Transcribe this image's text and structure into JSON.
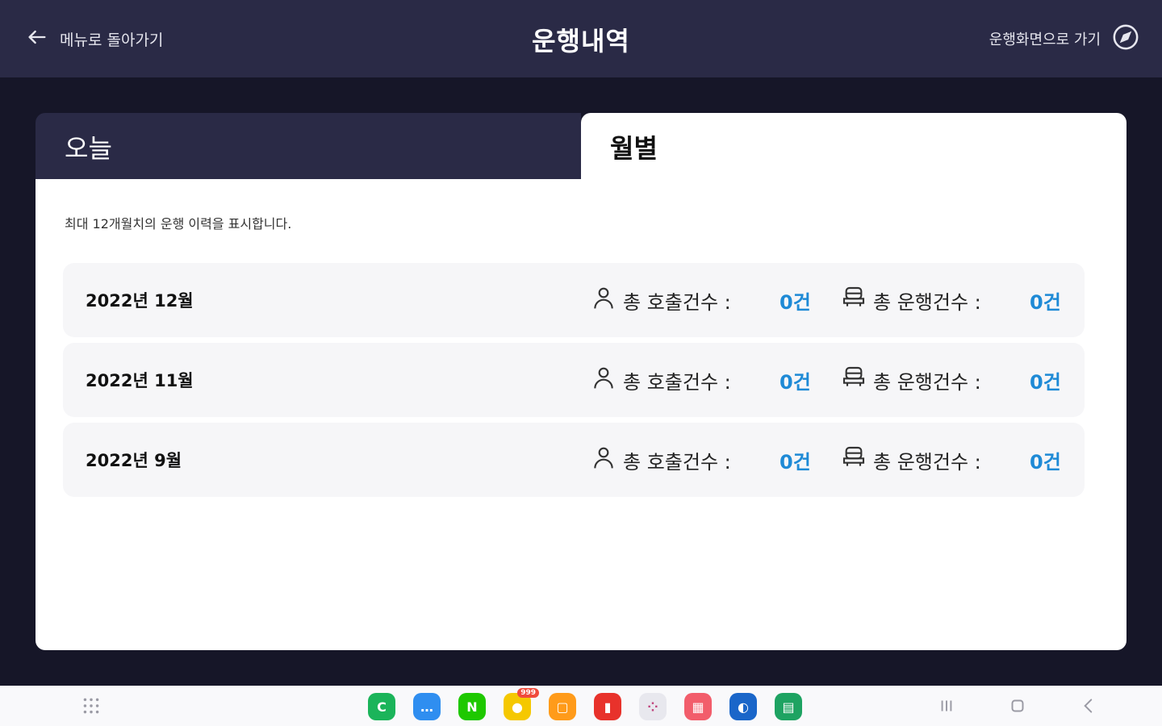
{
  "header": {
    "back_label": "메뉴로 돌아가기",
    "title": "운행내역",
    "goto_label": "운행화면으로 가기"
  },
  "tabs": [
    {
      "label": "오늘",
      "active": false
    },
    {
      "label": "월별",
      "active": true
    }
  ],
  "notice": "최대 12개월치의 운행 이력을 표시합니다.",
  "rows": [
    {
      "month": "2022년 12월",
      "call_label": "총 호출건수 :",
      "call_value": "0건",
      "drive_label": "총 운행건수 :",
      "drive_value": "0건"
    },
    {
      "month": "2022년 11월",
      "call_label": "총 호출건수 :",
      "call_value": "0건",
      "drive_label": "총 운행건수 :",
      "drive_value": "0건"
    },
    {
      "month": "2022년 9월",
      "call_label": "총 호출건수 :",
      "call_value": "0건",
      "drive_label": "총 운행건수 :",
      "drive_value": "0건"
    }
  ],
  "taskbar": {
    "apps": [
      {
        "name": "phone-app-icon",
        "glyph": "C",
        "color": "#1bb45a"
      },
      {
        "name": "messages-app-icon",
        "glyph": "…",
        "color": "#2f8ef0"
      },
      {
        "name": "naver-app-icon",
        "glyph": "N",
        "color": "#1ec800"
      },
      {
        "name": "kakaotalk-app-icon",
        "glyph": "●",
        "color": "#f5c800",
        "badge": "999"
      },
      {
        "name": "notes-app-icon",
        "glyph": "▢",
        "color": "#ff9b1a"
      },
      {
        "name": "memo-app-icon",
        "glyph": "▮",
        "color": "#e8322b"
      },
      {
        "name": "apps-folder-icon",
        "glyph": "⁘",
        "color": "#e8e8ee"
      },
      {
        "name": "calendar-app-icon",
        "glyph": "▦",
        "color": "#f25d6b"
      },
      {
        "name": "browser-app-icon",
        "glyph": "◐",
        "color": "#1a66c9"
      },
      {
        "name": "sheets-app-icon",
        "glyph": "▤",
        "color": "#1ea362"
      }
    ],
    "colors": {
      "accent_value": "#1e8ad6",
      "header_bg": "#2a2a46",
      "page_bg": "#161628"
    }
  }
}
